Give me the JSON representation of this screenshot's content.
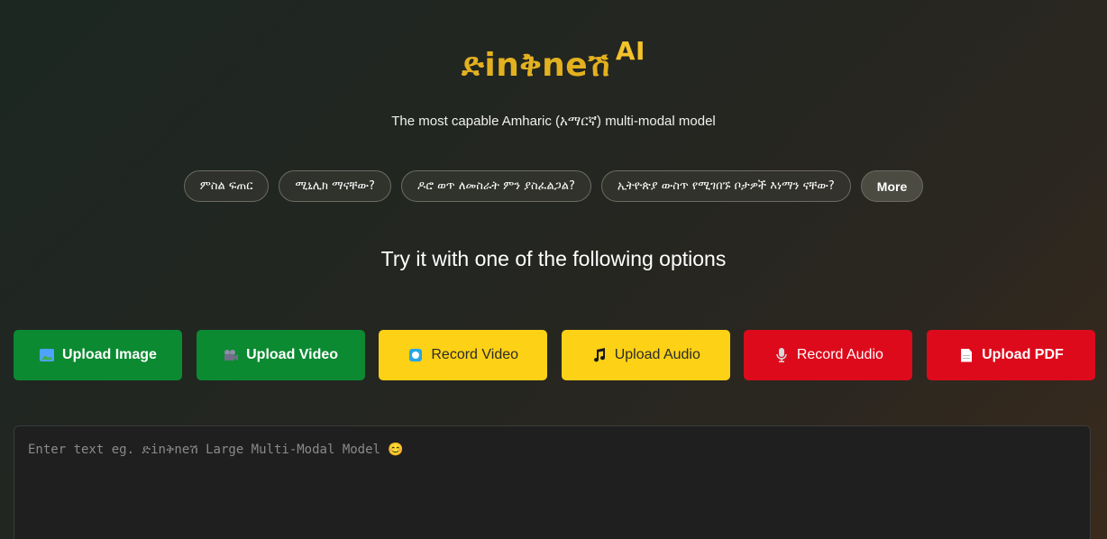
{
  "header": {
    "title": "ድinቅneሽ",
    "title_suffix": "AI",
    "subtitle": "The most capable Amharic (አማርኛ) multi-modal model"
  },
  "suggestions": [
    {
      "label": "ምስል ፍጠር"
    },
    {
      "label": "ሚኒሊክ ማናቸው?"
    },
    {
      "label": "ዶሮ ወጥ ለመስራት ምን ያስፈልጋል?"
    },
    {
      "label": "ኢትዮጵያ ውስጥ የሚገበኙ ቦታዎች እነማን ናቸው?"
    }
  ],
  "more_label": "More",
  "options_heading": "Try it with one of the following options",
  "actions": [
    {
      "label": "Upload Image",
      "icon": "image-icon",
      "color": "#0b8a32"
    },
    {
      "label": "Upload Video",
      "icon": "video-camera-icon",
      "color": "#0b8a32"
    },
    {
      "label": "Record Video",
      "icon": "record-icon",
      "color": "#fdd116"
    },
    {
      "label": "Upload Audio",
      "icon": "music-note-icon",
      "color": "#fdd116"
    },
    {
      "label": "Record Audio",
      "icon": "microphone-icon",
      "color": "#dd0a1c"
    },
    {
      "label": "Upload PDF",
      "icon": "document-icon",
      "color": "#dd0a1c"
    }
  ],
  "input": {
    "placeholder": "Enter text eg. ድinቅneሽ Large Multi-Modal Model 😊",
    "value": ""
  },
  "colors": {
    "accent": "#e3b11f",
    "green": "#0b8a32",
    "yellow": "#fdd116",
    "red": "#dd0a1c"
  }
}
